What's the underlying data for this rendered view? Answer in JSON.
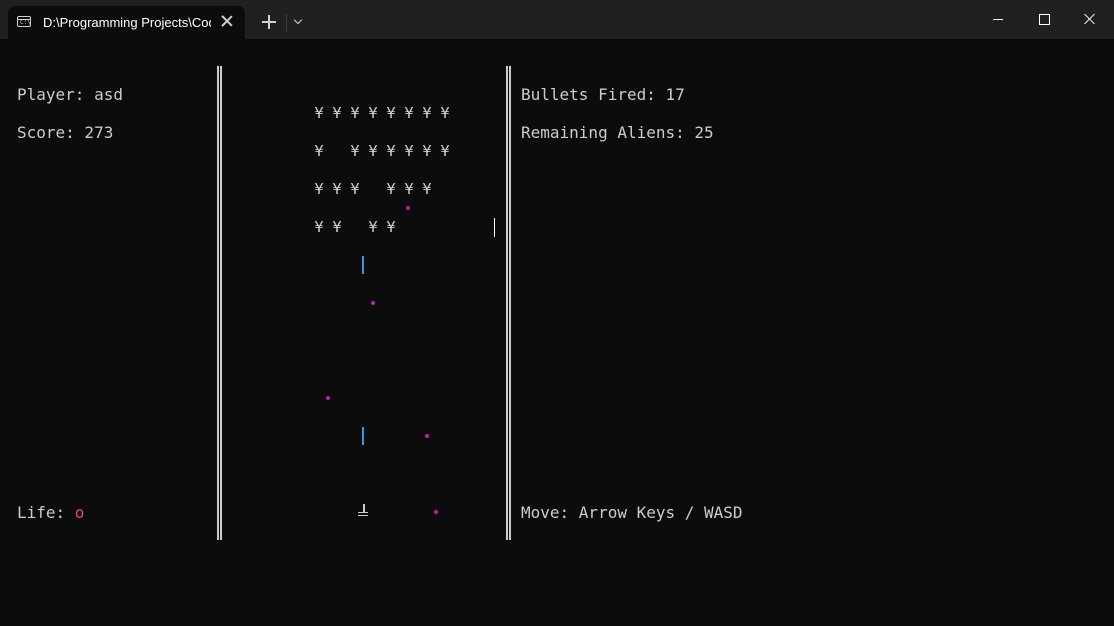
{
  "window": {
    "tab_title": "D:\\Programming Projects\\Cod",
    "icons": {
      "tab": "terminal-icon",
      "close_tab": "close-icon",
      "new_tab": "plus-icon",
      "tab_menu": "chevron-down-icon",
      "minimize": "minimize-icon",
      "maximize": "maximize-icon",
      "close_window": "close-icon"
    }
  },
  "game": {
    "player": "Player: asd",
    "score": "Score: 273",
    "life_label": "Life: ",
    "life_value": "o",
    "bullets_fired": "Bullets Fired: 17",
    "remaining_aliens": "Remaining Aliens: 25",
    "controls": "Move: Arrow Keys / WASD",
    "alien_glyph": "¥",
    "alien_rows": [
      [
        1,
        1,
        1,
        1,
        1,
        1,
        1,
        1
      ],
      [
        1,
        0,
        1,
        1,
        1,
        1,
        1,
        1
      ],
      [
        1,
        1,
        1,
        0,
        1,
        1,
        1,
        0
      ],
      [
        1,
        1,
        0,
        1,
        1,
        0,
        0,
        0
      ]
    ],
    "colors": {
      "text": "#cccccc",
      "life": "#e74856",
      "enemy_bullet": "#c01cb3",
      "player_bullet": "#3a96dd"
    }
  }
}
